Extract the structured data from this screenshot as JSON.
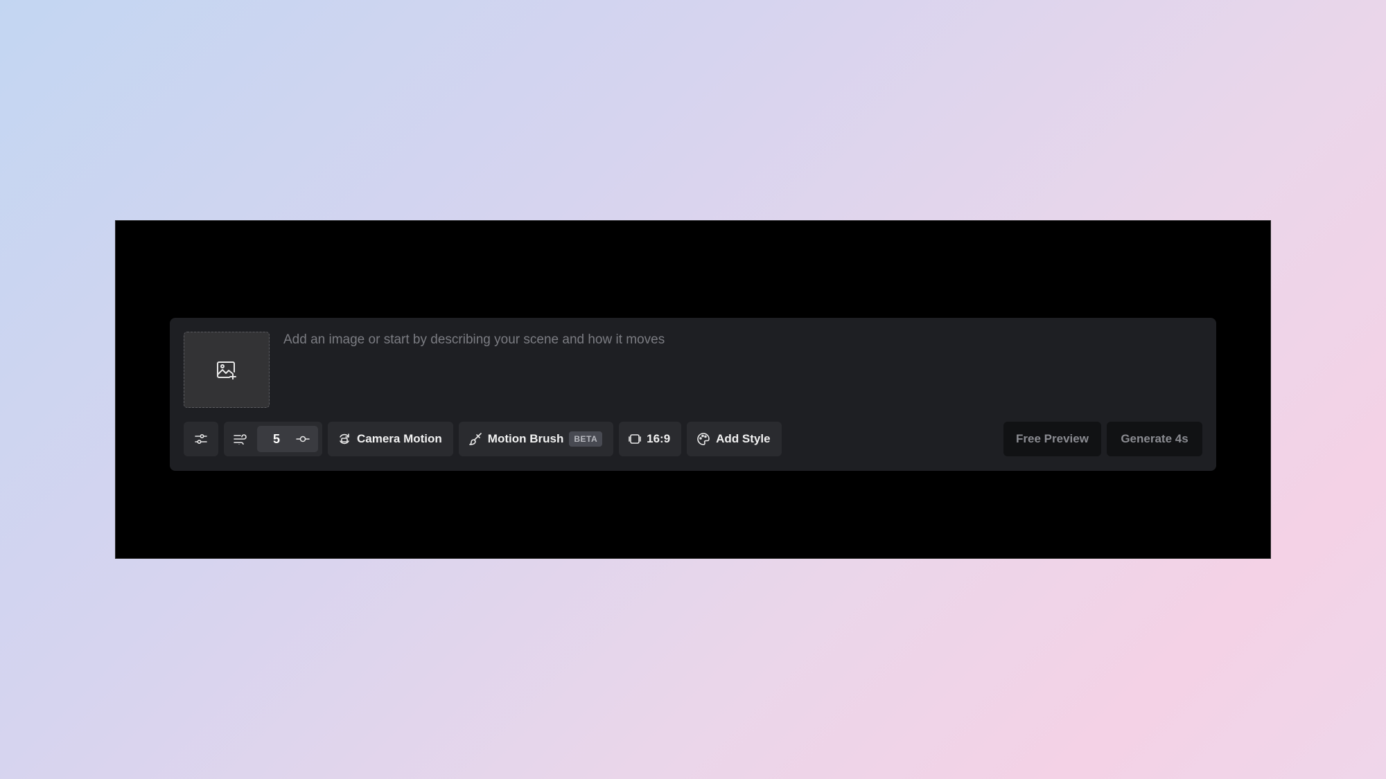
{
  "prompt": {
    "placeholder": "Add an image or start by describing your scene and how it moves"
  },
  "image_drop": {
    "icon": "image-add-icon"
  },
  "toolbar": {
    "settings_icon": "sliders-icon",
    "motion_icon": "motion-lines-icon",
    "motion_value": "5",
    "motion_adjust_icon": "slider-handle-icon",
    "camera_motion_label": "Camera Motion",
    "motion_brush_label": "Motion Brush",
    "motion_brush_badge": "BETA",
    "aspect_ratio_label": "16:9",
    "add_style_label": "Add Style"
  },
  "actions": {
    "free_preview_label": "Free Preview",
    "generate_label": "Generate 4s"
  },
  "colors": {
    "panel": "#1e1f23",
    "button": "#2a2b2f",
    "dark_button": "#111214"
  }
}
